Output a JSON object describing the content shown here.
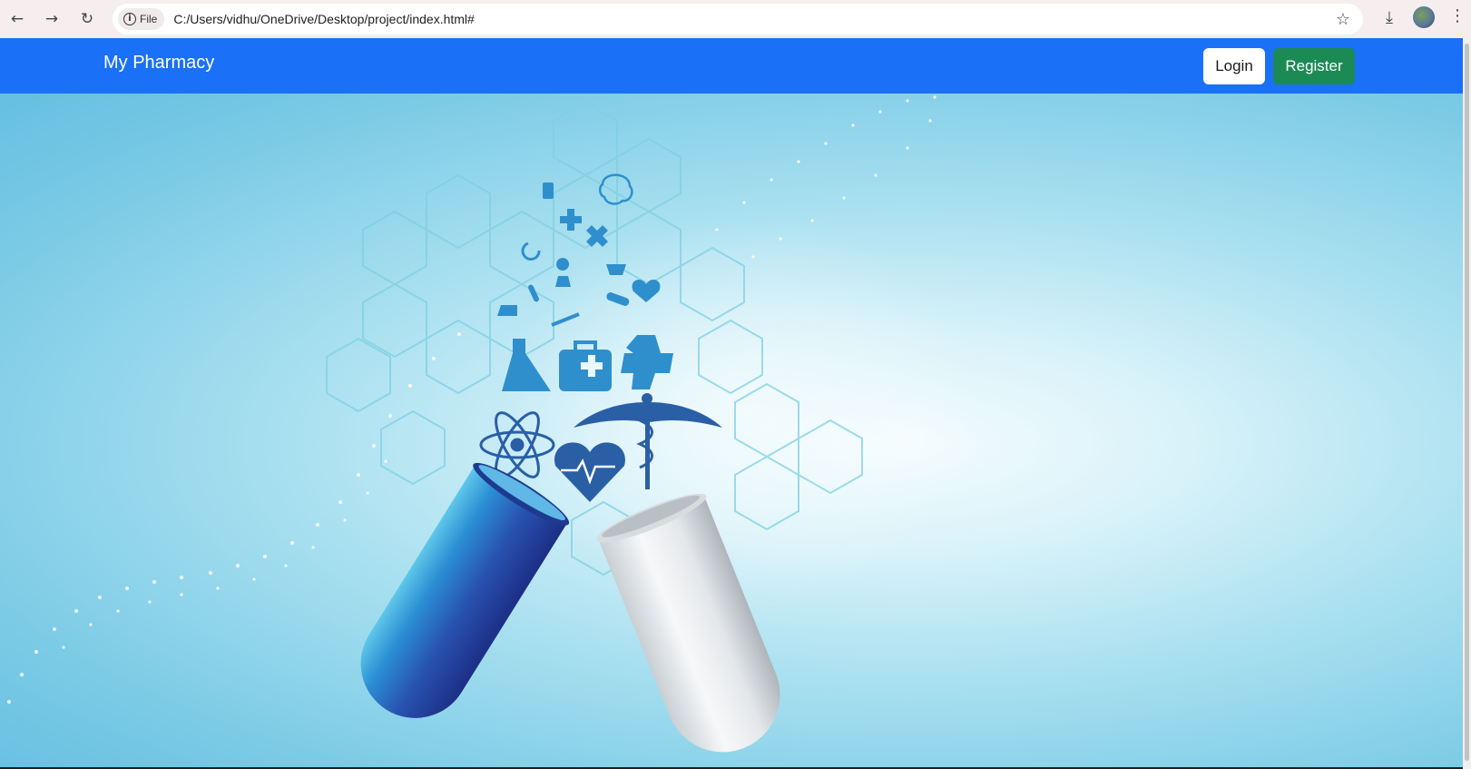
{
  "browser": {
    "site_chip": "File",
    "url": "C:/Users/vidhu/OneDrive/Desktop/project/index.html#"
  },
  "navbar": {
    "brand": "My Pharmacy",
    "login_label": "Login",
    "register_label": "Register"
  },
  "colors": {
    "navbar": "#1a70f6",
    "register_button": "#1c8a55",
    "hero_sky": "#7ccbe6"
  },
  "hero": {
    "image": "open medicine capsule with medical icons (hexagon network, DNA particle wave)"
  }
}
